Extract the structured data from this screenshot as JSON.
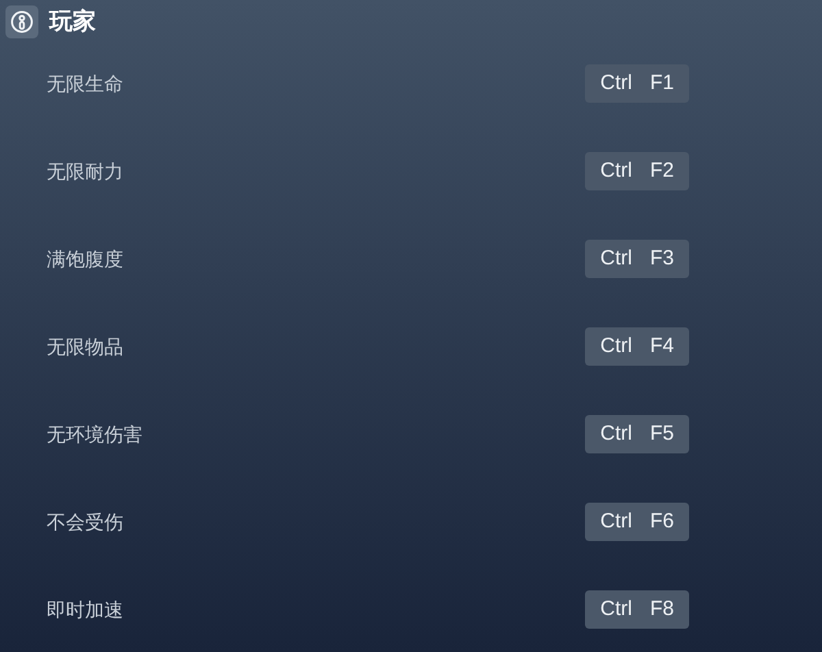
{
  "section": {
    "title": "玩家"
  },
  "cheats": [
    {
      "label": "无限生命",
      "keys": [
        "Ctrl",
        "F1"
      ]
    },
    {
      "label": "无限耐力",
      "keys": [
        "Ctrl",
        "F2"
      ]
    },
    {
      "label": "满饱腹度",
      "keys": [
        "Ctrl",
        "F3"
      ]
    },
    {
      "label": "无限物品",
      "keys": [
        "Ctrl",
        "F4"
      ]
    },
    {
      "label": "无环境伤害",
      "keys": [
        "Ctrl",
        "F5"
      ]
    },
    {
      "label": "不会受伤",
      "keys": [
        "Ctrl",
        "F6"
      ]
    },
    {
      "label": "即时加速",
      "keys": [
        "Ctrl",
        "F8"
      ]
    }
  ]
}
